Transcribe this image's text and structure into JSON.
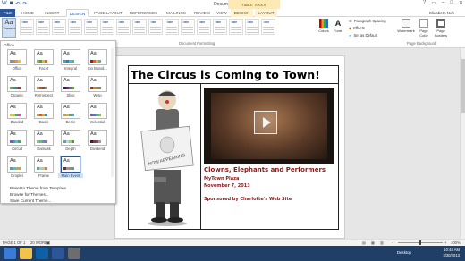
{
  "window": {
    "title": "Document1 - Word",
    "context_tab_header": "TABLE TOOLS",
    "user": "Elizabeth Noh"
  },
  "tabs": [
    {
      "label": "FILE"
    },
    {
      "label": "HOME"
    },
    {
      "label": "INSERT"
    },
    {
      "label": "DESIGN"
    },
    {
      "label": "PAGE LAYOUT"
    },
    {
      "label": "REFERENCES"
    },
    {
      "label": "MAILINGS"
    },
    {
      "label": "REVIEW"
    },
    {
      "label": "VIEW"
    },
    {
      "label": "DESIGN"
    },
    {
      "label": "LAYOUT"
    }
  ],
  "ribbon": {
    "themes_label": "Themes",
    "style_title": "Title",
    "style_count": 16,
    "colors_label": "Colors",
    "fonts_label": "Fonts",
    "paragraph_spacing": "Paragraph Spacing",
    "effects": "Effects",
    "set_as_default": "Set as Default",
    "watermark": "Watermark",
    "page_color": "Page Color",
    "page_borders": "Page Borders",
    "group_document_formatting": "Document Formatting",
    "group_page_background": "Page Background"
  },
  "themes_panel": {
    "header": "Office",
    "themes": [
      {
        "name": "Office",
        "colors": [
          "#5b9bd5",
          "#ed7d31",
          "#a5a5a5",
          "#ffc000"
        ]
      },
      {
        "name": "Facet",
        "colors": [
          "#90c226",
          "#54a021",
          "#e6b91e",
          "#e76618"
        ]
      },
      {
        "name": "Integral",
        "colors": [
          "#1cade4",
          "#2683c6",
          "#27ced7",
          "#42ba97"
        ]
      },
      {
        "name": "Ion Board...",
        "colors": [
          "#b01513",
          "#ea6312",
          "#e6b729",
          "#6aac90"
        ]
      },
      {
        "name": "Organic",
        "colors": [
          "#83992a",
          "#3c9770",
          "#44709d",
          "#a23c33"
        ]
      },
      {
        "name": "Retrospect",
        "colors": [
          "#e48312",
          "#bd582c",
          "#865640",
          "#9b8357"
        ]
      },
      {
        "name": "Slice",
        "colors": [
          "#052f61",
          "#a50e82",
          "#14967c",
          "#6a9e1f"
        ]
      },
      {
        "name": "Wisp",
        "colors": [
          "#a53010",
          "#de7e18",
          "#9f8351",
          "#728653"
        ]
      },
      {
        "name": "Banded",
        "colors": [
          "#ffc000",
          "#a5d028",
          "#08cc78",
          "#f24099"
        ]
      },
      {
        "name": "Basis",
        "colors": [
          "#a6b727",
          "#df5327",
          "#fe9e00",
          "#418ab3"
        ]
      },
      {
        "name": "Berlin",
        "colors": [
          "#f09415",
          "#c1b56b",
          "#4baf73",
          "#5aa6c0"
        ]
      },
      {
        "name": "Celestial",
        "colors": [
          "#ac3ec1",
          "#477bd1",
          "#46b298",
          "#90ba4c"
        ]
      },
      {
        "name": "Circuit",
        "colors": [
          "#914ecb",
          "#3c9ef2",
          "#50c3c7",
          "#4ca94a"
        ]
      },
      {
        "name": "Damask",
        "colors": [
          "#9ec544",
          "#50bea3",
          "#4a9ccc",
          "#9a66ca"
        ]
      },
      {
        "name": "Depth",
        "colors": [
          "#41aebd",
          "#97e9d5",
          "#a2cf49",
          "#608f3d"
        ]
      },
      {
        "name": "Dividend",
        "colors": [
          "#4d1434",
          "#903163",
          "#b2324b",
          "#969fa7"
        ]
      },
      {
        "name": "Droplet",
        "colors": [
          "#2fa3ee",
          "#4bcaad",
          "#86c157",
          "#d99c3f"
        ]
      },
      {
        "name": "Frame",
        "colors": [
          "#40a7c2",
          "#a0d2c6",
          "#d5c85c",
          "#d9716d"
        ]
      },
      {
        "name": "Main Event",
        "colors": [
          "#b80e0f",
          "#a6987d",
          "#7f9a71",
          "#64969f"
        ]
      }
    ],
    "selected_theme": "Main Event",
    "menu": [
      {
        "label": "Reset to Theme from Template"
      },
      {
        "label": "Browse for Themes..."
      },
      {
        "label": "Save Current Theme..."
      }
    ]
  },
  "document": {
    "heading": "The Circus is Coming to Town!",
    "line1": "Clowns, Elephants and Performers",
    "line2": "MyTown Plaza",
    "line3": "November 7, 2013",
    "line4": "Sponsored by Charlotte's Web Site",
    "clown_sign": "NOW APPEARING"
  },
  "status": {
    "page": "PAGE 1 OF 1",
    "words": "20 WORDS",
    "zoom": "100%",
    "zoom_level": 100
  },
  "taskbar": {
    "desktop": "Desktop",
    "time": "10:48 AM",
    "date": "3/30/2013"
  },
  "colors": {
    "accent": "#2b579a",
    "doc_text": "#8b1a1a",
    "taskbar": "#1f3f66"
  }
}
